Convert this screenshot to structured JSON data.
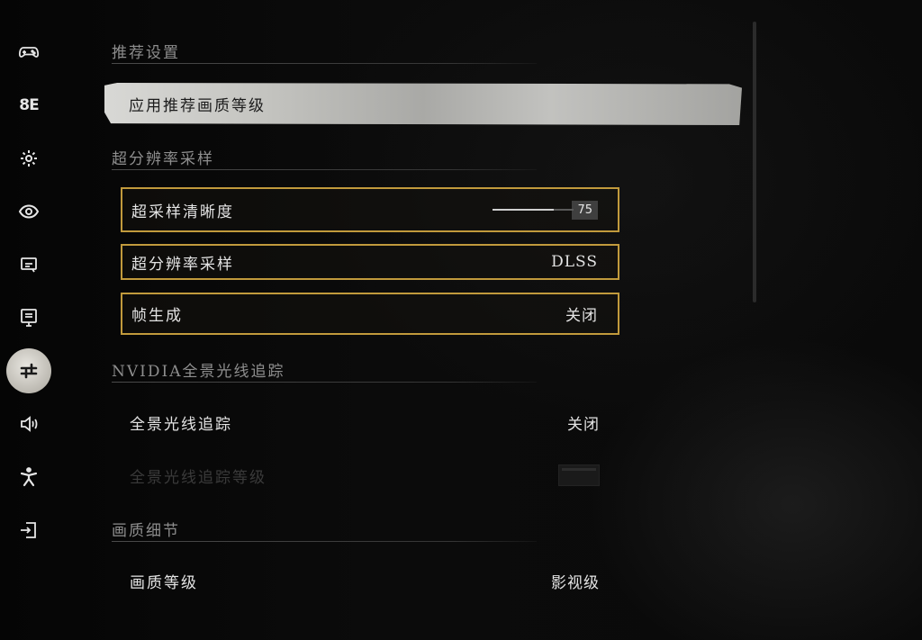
{
  "sidebar": {
    "items": [
      {
        "name": "gamepad-icon",
        "active": false
      },
      {
        "name": "keyboard-icon",
        "text": "8E",
        "active": false
      },
      {
        "name": "gear-icon",
        "active": false
      },
      {
        "name": "eye-icon",
        "active": false
      },
      {
        "name": "subtitle-icon",
        "active": false
      },
      {
        "name": "monitor-icon",
        "active": false
      },
      {
        "name": "sliders-icon",
        "active": true
      },
      {
        "name": "audio-icon",
        "active": false
      },
      {
        "name": "accessibility-icon",
        "active": false
      },
      {
        "name": "exit-icon",
        "active": false
      }
    ]
  },
  "sections": {
    "recommended": "推荐设置",
    "super_res": "超分辨率采样",
    "nvidia": "NVIDIA全景光线追踪",
    "detail": "画质细节"
  },
  "apply_button": "应用推荐画质等级",
  "rows": {
    "supersampling": {
      "label": "超采样清晰度",
      "value": "75",
      "fraction": 0.75
    },
    "upscaling": {
      "label": "超分辨率采样",
      "value": "DLSS"
    },
    "frame_gen": {
      "label": "帧生成",
      "value": "关闭"
    },
    "rt": {
      "label": "全景光线追踪",
      "value": "关闭"
    },
    "rt_level": {
      "label": "全景光线追踪等级"
    },
    "quality": {
      "label": "画质等级",
      "value": "影视级"
    }
  },
  "colors": {
    "highlight_frame": "#c19a3c",
    "active_nav": "#d6d4ce"
  }
}
